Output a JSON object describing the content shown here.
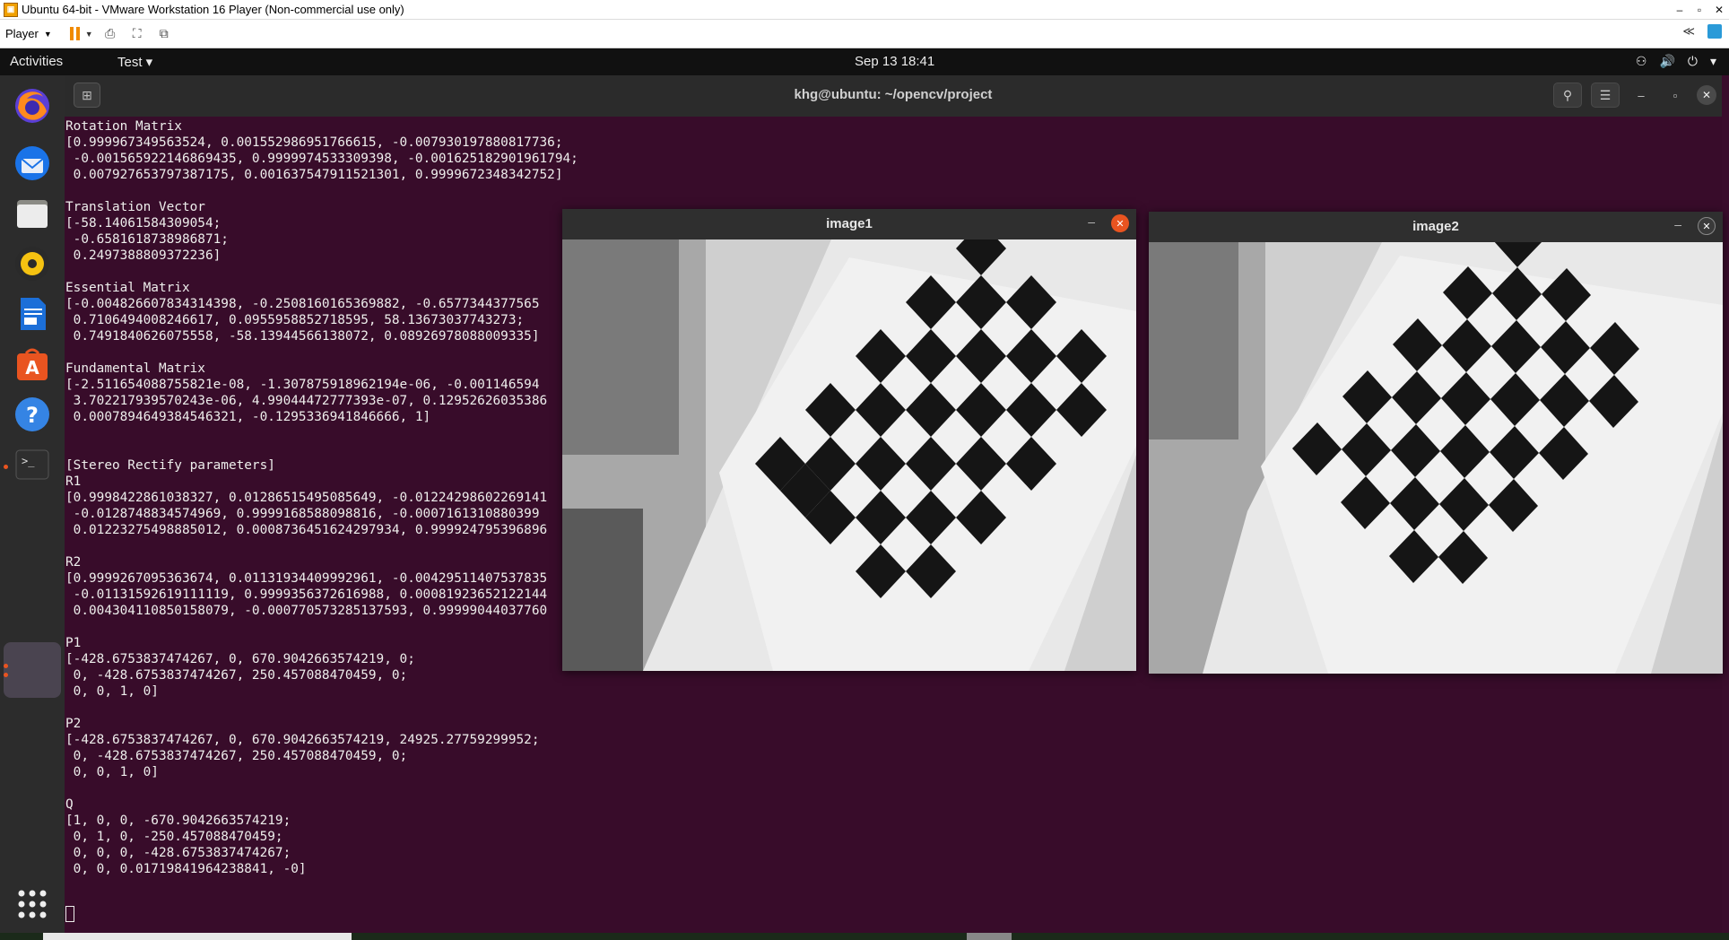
{
  "vmware": {
    "title": "Ubuntu 64-bit - VMware Workstation 16 Player (Non-commercial use only)",
    "player_menu": "Player",
    "window_controls": [
      "–",
      "▫",
      "✕"
    ]
  },
  "gnome": {
    "activities": "Activities",
    "app_menu": "Test ▾",
    "clock": "Sep 13  18:41",
    "tray": [
      "⚇",
      "🔊",
      "⏻",
      "▾"
    ]
  },
  "dock": {
    "items": [
      "firefox-icon",
      "thunderbird-icon",
      "files-icon",
      "rhythmbox-icon",
      "libreoffice-writer-icon",
      "ubuntu-software-icon",
      "help-icon",
      "terminal-icon",
      "active-app"
    ],
    "show_apps": "show-applications-icon"
  },
  "terminal": {
    "title": "khg@ubuntu: ~/opencv/project",
    "lines": [
      "Rotation Matrix",
      "[0.999967349563524, 0.001552986951766615, -0.007930197880817736;",
      " -0.001565922146869435, 0.9999974533309398, -0.001625182901961794;",
      " 0.007927653797387175, 0.001637547911521301, 0.9999672348342752]",
      "",
      "Translation Vector",
      "[-58.14061584309054;",
      " -0.6581618738986871;",
      " 0.2497388809372236]",
      "",
      "Essential Matrix",
      "[-0.004826607834314398, -0.2508160165369882, -0.6577344377565",
      " 0.7106494008246617, 0.0955958852718595, 58.13673037743273;",
      " 0.7491840626075558, -58.13944566138072, 0.08926978088009335]",
      "",
      "Fundamental Matrix",
      "[-2.511654088755821e-08, -1.307875918962194e-06, -0.001146594",
      " 3.702217939570243e-06, 4.99044472777393e-07, 0.12952626035386",
      " 0.0007894649384546321, -0.1295336941846666, 1]",
      "",
      "",
      "[Stereo Rectify parameters]",
      "R1",
      "[0.9998422861038327, 0.01286515495085649, -0.01224298602269141",
      " -0.0128748834574969, 0.9999168588098816, -0.0007161310880399",
      " 0.01223275498885012, 0.0008736451624297934, 0.999924795396896",
      "",
      "R2",
      "[0.9999267095363674, 0.01131934409992961, -0.00429511407537835",
      " -0.01131592619111119, 0.9999356372616988, 0.00081923652122144",
      " 0.004304110850158079, -0.000770573285137593, 0.99999044037760",
      "",
      "P1",
      "[-428.6753837474267, 0, 670.9042663574219, 0;",
      " 0, -428.6753837474267, 250.457088470459, 0;",
      " 0, 0, 1, 0]",
      "",
      "P2",
      "[-428.6753837474267, 0, 670.9042663574219, 24925.27759299952;",
      " 0, -428.6753837474267, 250.457088470459, 0;",
      " 0, 0, 1, 0]",
      "",
      "Q",
      "[1, 0, 0, -670.9042663574219;",
      " 0, 1, 0, -250.457088470459;",
      " 0, 0, 0, -428.6753837474267;",
      " 0, 0, 0.01719841964238841, -0]"
    ]
  },
  "windows": {
    "image1": {
      "title": "image1"
    },
    "image2": {
      "title": "image2"
    }
  },
  "colors": {
    "terminal_bg": "#380c2a",
    "ubuntu_orange": "#e95420",
    "close_button": "#e95420"
  }
}
